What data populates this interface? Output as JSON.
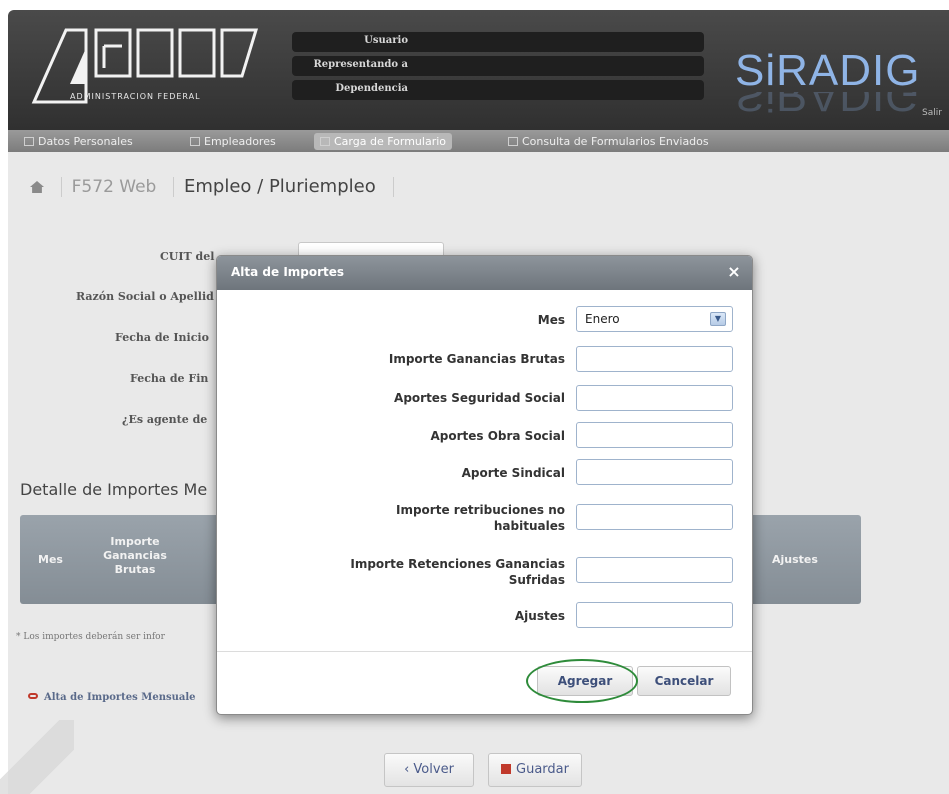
{
  "header": {
    "logo_caption": "ADMINISTRACION FEDERAL",
    "user_labels": [
      "Usuario",
      "Representando a",
      "Dependencia"
    ],
    "brand": "SiRADIG",
    "logout": "Salir"
  },
  "nav": {
    "items": [
      {
        "label": "Datos Personales",
        "active": false
      },
      {
        "label": "Empleadores",
        "active": false
      },
      {
        "label": "Carga de Formulario",
        "active": true
      },
      {
        "label": "Consulta de Formularios Enviados",
        "active": false
      }
    ]
  },
  "breadcrumb": {
    "form": "F572 Web",
    "page": "Empleo / Pluriempleo"
  },
  "background_form": {
    "labels": [
      "CUIT del",
      "Razón Social o Apellid",
      "Fecha de Inicio",
      "Fecha de Fin",
      "¿Es agente de"
    ]
  },
  "detail": {
    "title": "Detalle de Importes Me",
    "columns": [
      "Mes",
      "Importe Ganancias Brutas",
      "Ajustes"
    ],
    "note": "* Los importes deberán ser infor",
    "add_link": "Alta de Importes Mensuale"
  },
  "footer": {
    "back_label": "Volver",
    "save_label": "Guardar"
  },
  "modal": {
    "title": "Alta de Importes",
    "close": "×",
    "month_label": "Mes",
    "month_value": "Enero",
    "fields": [
      {
        "label": "Importe Ganancias Brutas",
        "value": ""
      },
      {
        "label": "Aportes Seguridad Social",
        "value": ""
      },
      {
        "label": "Aportes Obra Social",
        "value": ""
      },
      {
        "label": "Aporte Sindical",
        "value": ""
      },
      {
        "label": "Importe retribuciones no habituales",
        "value": ""
      },
      {
        "label": "Importe Retenciones Ganancias Sufridas",
        "value": ""
      },
      {
        "label": "Ajustes",
        "value": ""
      }
    ],
    "add_label": "Agregar",
    "cancel_label": "Cancelar"
  },
  "colors": {
    "header_bg": "#3a3a3a",
    "brand": "#8fb4e6",
    "modal_header": "#7d848b",
    "highlight": "#2e8b3a",
    "link_accent": "#c0392b"
  }
}
